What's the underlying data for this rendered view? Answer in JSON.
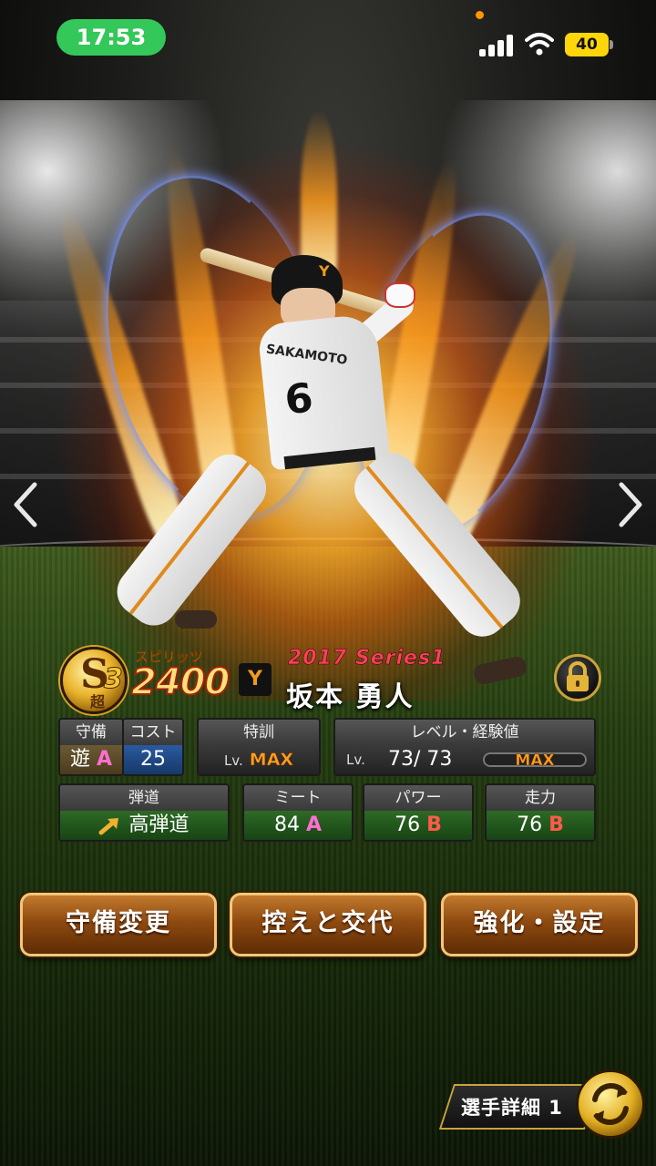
{
  "status_bar": {
    "time": "17:53",
    "battery": "40"
  },
  "player": {
    "rank_letter": "S",
    "rank_sub": "超",
    "rank_num": "3",
    "spirits_label": "スピリッツ",
    "spirits_value": "2400",
    "team_logo": "Y",
    "series": "2017 Series1",
    "name": "坂本 勇人",
    "jersey_name": "SAKAMOTO",
    "jersey_number": "6"
  },
  "stats": {
    "defense": {
      "header": "守備",
      "position": "遊",
      "grade": "A"
    },
    "cost": {
      "header": "コスト",
      "value": "25"
    },
    "special": {
      "header": "特訓",
      "lv_label": "Lv.",
      "value": "MAX"
    },
    "level": {
      "header": "レベル・経験値",
      "lv_label": "Lv.",
      "value": "73/ 73",
      "exp_label": "MAX"
    },
    "trajectory": {
      "header": "弾道",
      "value": "高弾道"
    },
    "meet": {
      "header": "ミート",
      "value": "84",
      "grade": "A"
    },
    "power": {
      "header": "パワー",
      "value": "76",
      "grade": "B"
    },
    "speed": {
      "header": "走力",
      "value": "76",
      "grade": "B"
    }
  },
  "buttons": {
    "change_position": "守備変更",
    "substitute": "控えと交代",
    "enhance": "強化・設定",
    "detail": "選手詳細 1"
  },
  "icons": {
    "lock": "lock-icon",
    "swap": "swap-icon",
    "prev": "chevron-left-icon",
    "next": "chevron-right-icon",
    "trajectory_arrow": "arrow-up-right-icon"
  },
  "colors": {
    "status_pill": "#34c759",
    "battery": "#ffd60a",
    "stat_body_green": "#1f4a1a",
    "cost_body_blue": "#1d3f7a",
    "defense_body_tan": "#5a4a2a",
    "button_brown": "#8f4a10",
    "gold_border": "#f0c878"
  }
}
